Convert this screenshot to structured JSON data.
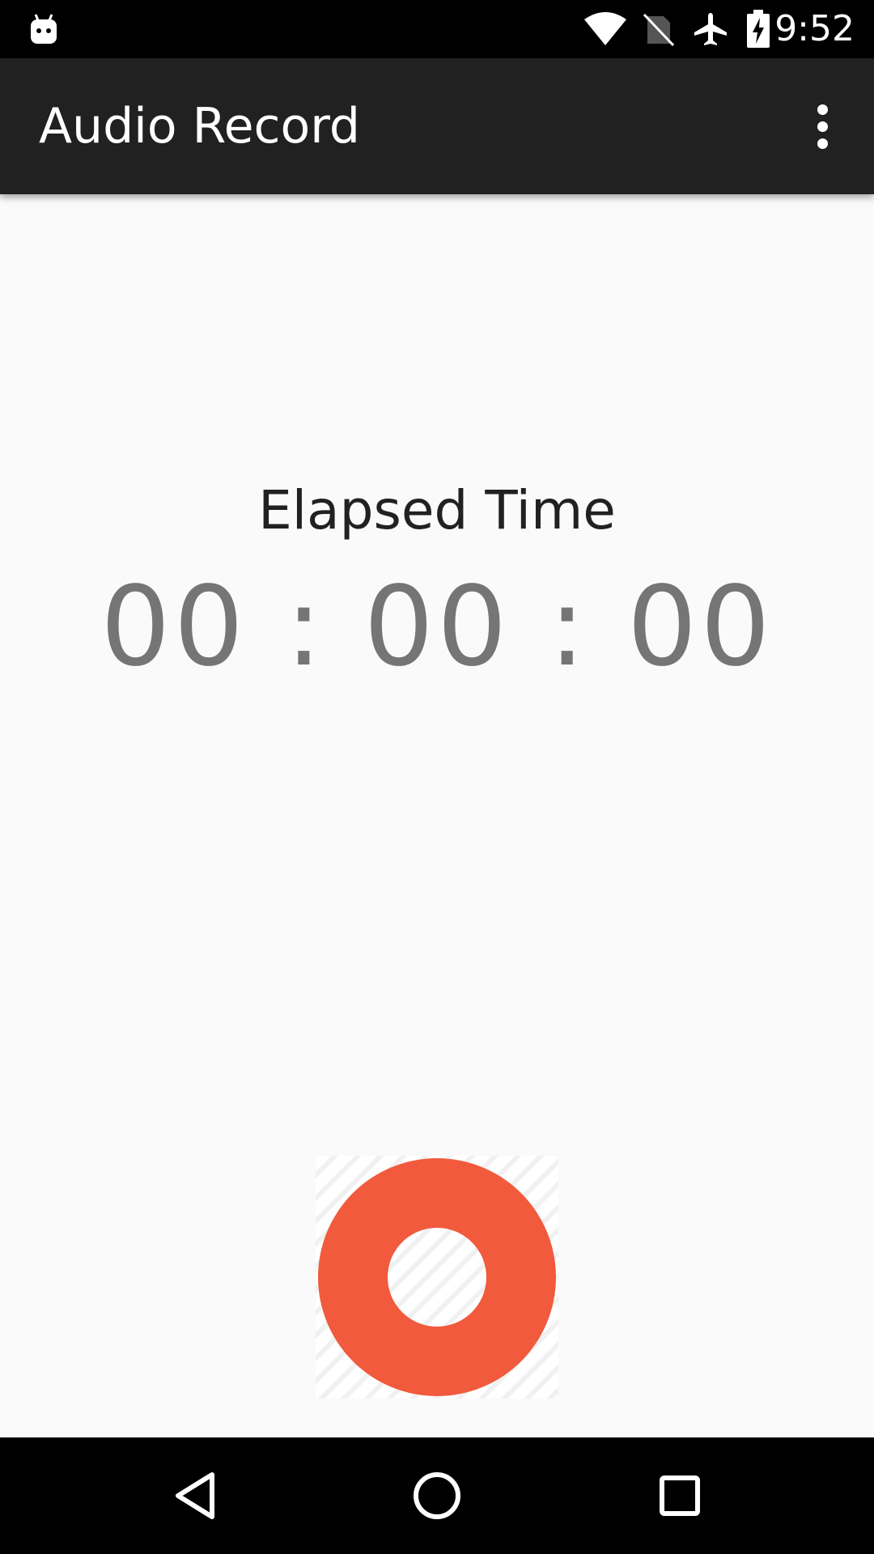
{
  "status_bar": {
    "time": "9:52",
    "icons": [
      "android-notification-icon",
      "wifi-icon",
      "no-sim-icon",
      "airplane-mode-icon",
      "battery-charging-icon"
    ]
  },
  "app_bar": {
    "title": "Audio Record",
    "menu_icon": "more-vert-icon"
  },
  "main": {
    "elapsed_label": "Elapsed Time",
    "elapsed_time": "00 : 00 : 00",
    "record_button_icon": "record-icon"
  },
  "nav_bar": {
    "back_icon": "back-icon",
    "home_icon": "home-icon",
    "recents_icon": "recents-icon"
  },
  "colors": {
    "status_bar_bg": "#000000",
    "app_bar_bg": "#212121",
    "background": "#fafafa",
    "record_accent": "#f15a3c",
    "timer_text": "#757575"
  }
}
